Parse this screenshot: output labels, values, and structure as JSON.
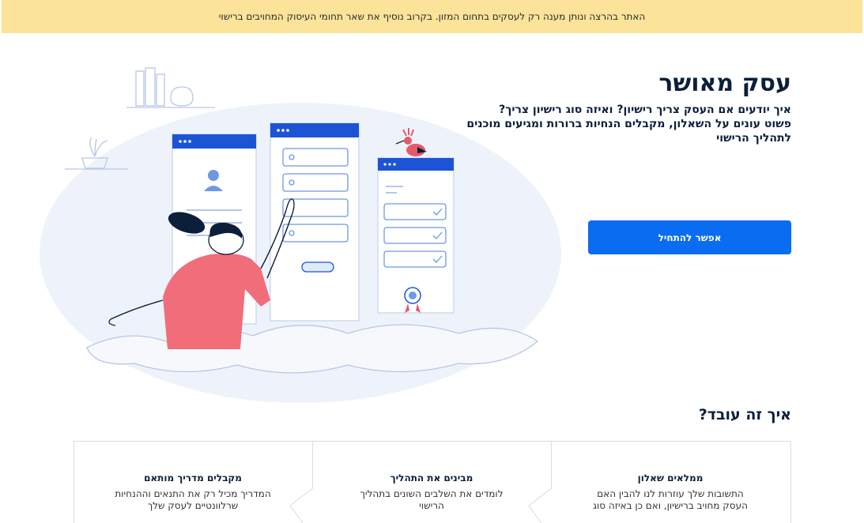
{
  "banner": {
    "text": "האתר בהרצה ונותן מענה רק לעסקים בתחום המזון. בקרוב נוסיף את שאר תחומי העיסוק המחויבים ברישוי"
  },
  "hero": {
    "title": "עסק מאושר",
    "subtitle_lines": [
      "איך יודעים אם העסק צריך רישיון? ואיזה סוג רישיון צריך?",
      "פשוט עונים על השאלון, מקבלים הנחיות ברורות ומגיעים מוכנים",
      "לתהליך הרישוי"
    ],
    "cta_label": "אפשר להתחיל"
  },
  "how": {
    "title": "איך זה עובד?",
    "steps": [
      {
        "title": "ממלאים שאלון",
        "lines": [
          "התשובות שלך עוזרות לנו להבין האם",
          "העסק מחויב ברישיון, ואם כן באיזה סוג"
        ]
      },
      {
        "title": "מבינים את התהליך",
        "lines": [
          "לומדים את השלבים השונים בתהליך",
          "הרישוי"
        ]
      },
      {
        "title": "מקבלים מדריך מותאם",
        "lines": [
          "המדריך מכיל רק את התנאים וההנחיות",
          "שרלוונטיים לעסק שלך"
        ]
      }
    ]
  },
  "colors": {
    "banner": "#fbe39a",
    "primary": "#0a6cf0",
    "title": "#0b1f3a"
  }
}
